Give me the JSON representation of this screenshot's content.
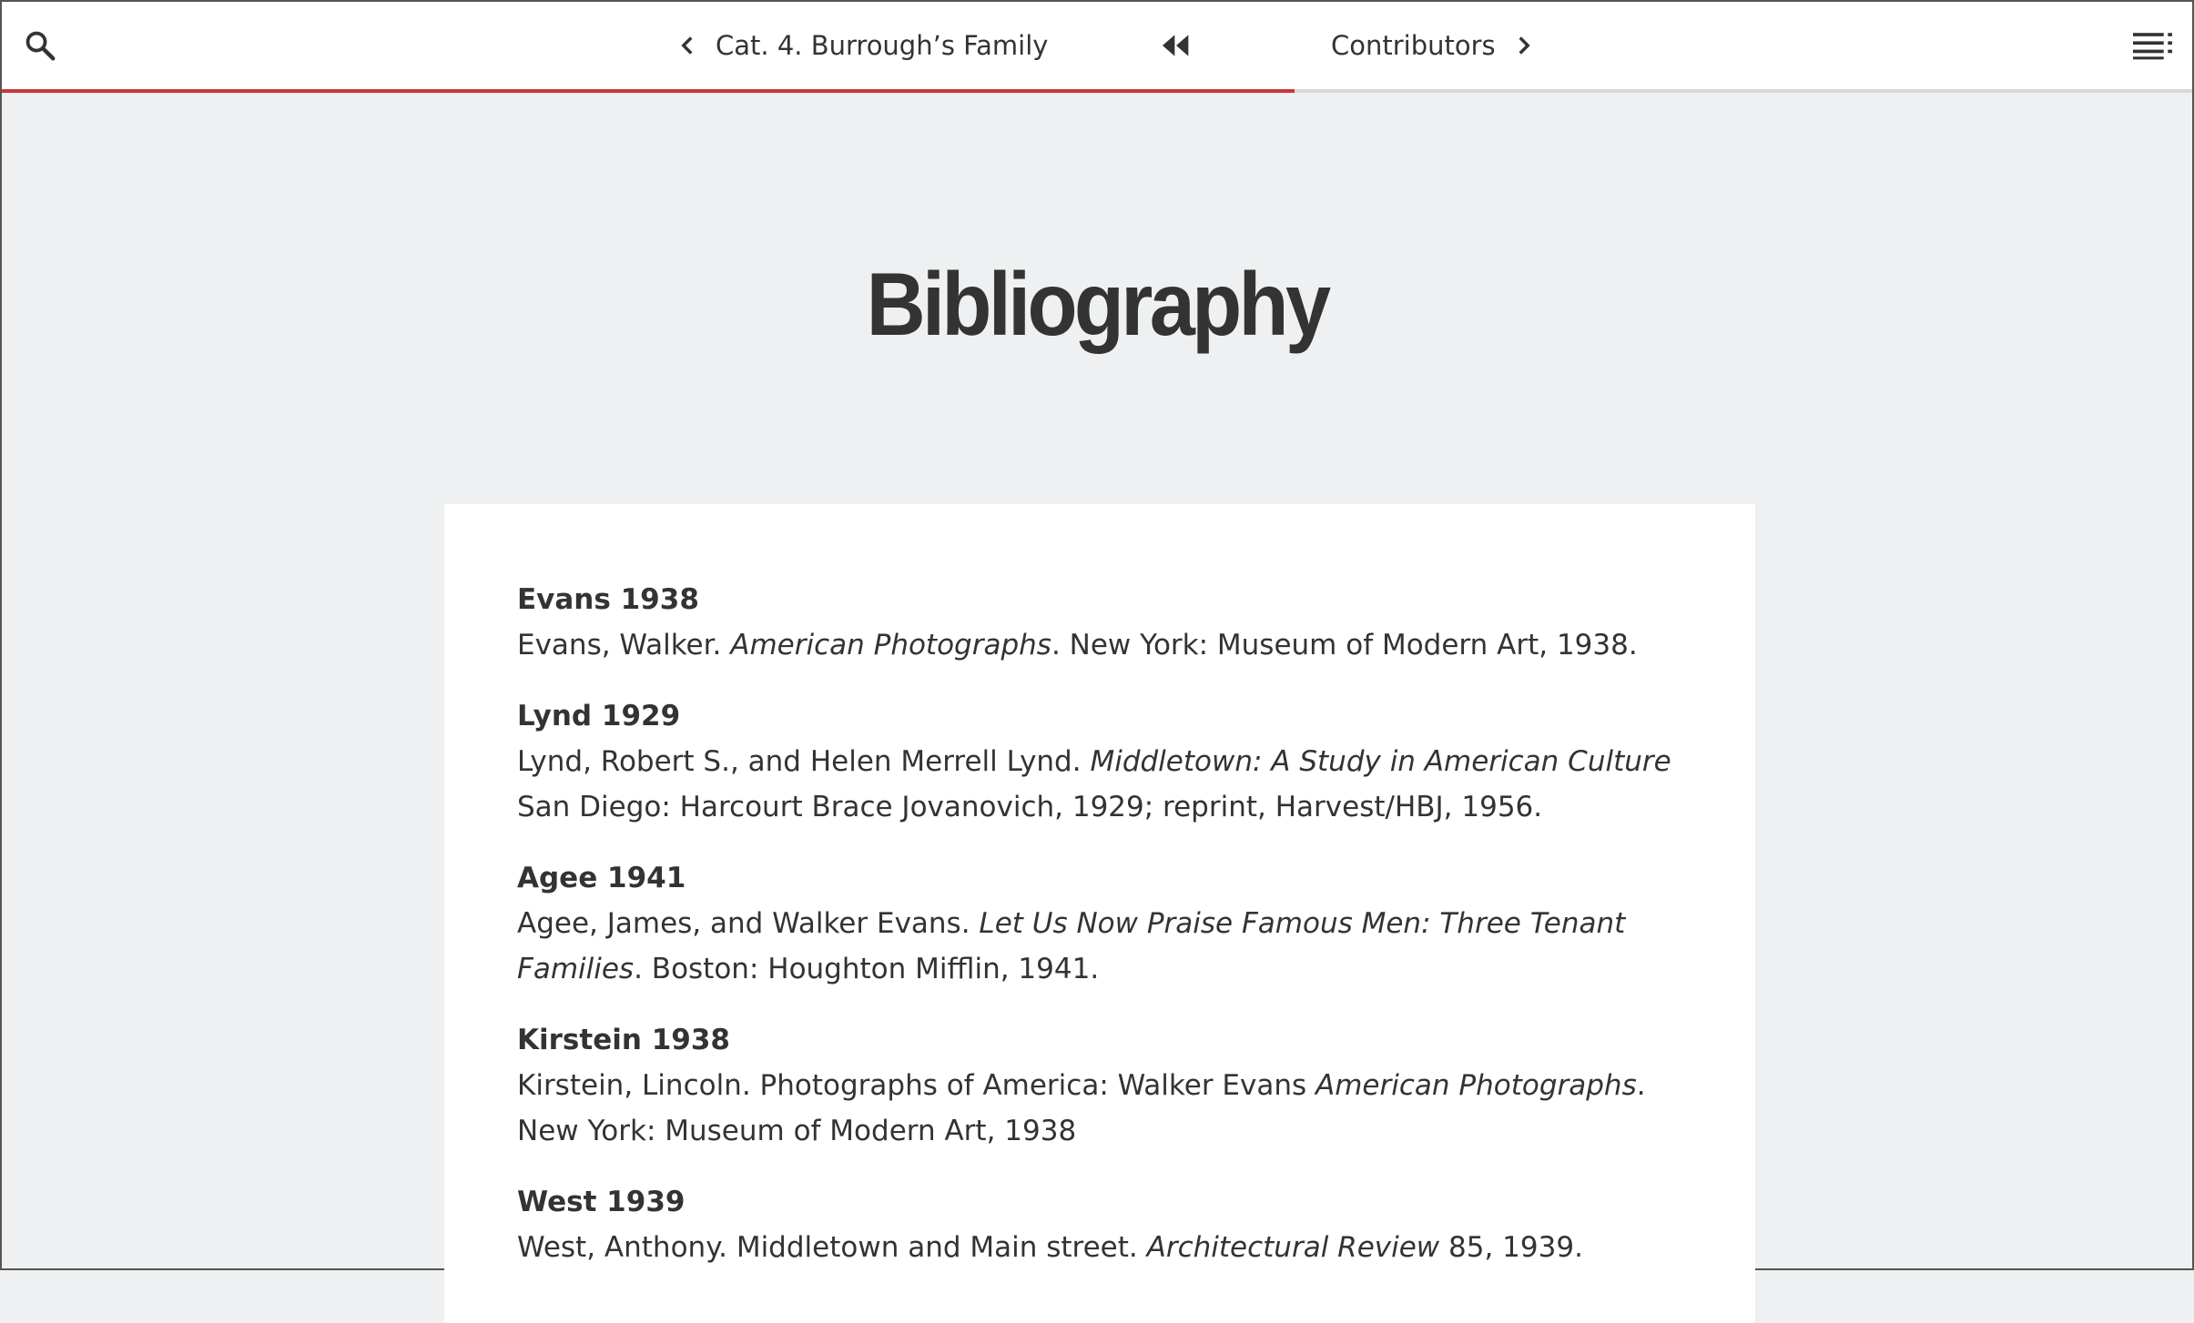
{
  "nav": {
    "prev_label": "Cat. 4. Burrough’s Family",
    "next_label": "Contributors",
    "progress_fraction": 0.59,
    "accent_color": "#c8373a",
    "icons": {
      "search": "search-icon",
      "prev": "chevron-left-icon",
      "home": "double-chevron-left-icon",
      "next": "chevron-right-icon",
      "menu": "menu-list-icon"
    }
  },
  "page": {
    "title": "Bibliography"
  },
  "entries": [
    {
      "key": "Evans 1938",
      "parts": [
        {
          "text": "Evans, Walker. ",
          "italic": false
        },
        {
          "text": "American Photographs",
          "italic": true
        },
        {
          "text": ". New York: Museum of Modern Art, 1938.",
          "italic": false
        }
      ]
    },
    {
      "key": "Lynd 1929",
      "parts": [
        {
          "text": "Lynd, Robert S., and Helen Merrell Lynd. ",
          "italic": false
        },
        {
          "text": "Middletown: A Study in American Culture",
          "italic": true
        },
        {
          "text": " San Diego: Harcourt Brace Jovanovich, 1929; reprint, Harvest/HBJ, 1956.",
          "italic": false
        }
      ]
    },
    {
      "key": "Agee 1941",
      "parts": [
        {
          "text": "Agee, James, and Walker Evans. ",
          "italic": false
        },
        {
          "text": "Let Us Now Praise Famous Men: Three Tenant Families",
          "italic": true
        },
        {
          "text": ". Boston: Houghton Mifflin, 1941.",
          "italic": false
        }
      ]
    },
    {
      "key": "Kirstein 1938",
      "parts": [
        {
          "text": "Kirstein, Lincoln. Photographs of America: Walker Evans ",
          "italic": false
        },
        {
          "text": "American Photographs",
          "italic": true
        },
        {
          "text": ". New York: Museum of Modern Art, 1938",
          "italic": false
        }
      ]
    },
    {
      "key": "West 1939",
      "parts": [
        {
          "text": "West, Anthony. Middletown and Main street. ",
          "italic": false
        },
        {
          "text": "Architectural Review",
          "italic": true
        },
        {
          "text": " 85, 1939.",
          "italic": false
        }
      ]
    }
  ]
}
